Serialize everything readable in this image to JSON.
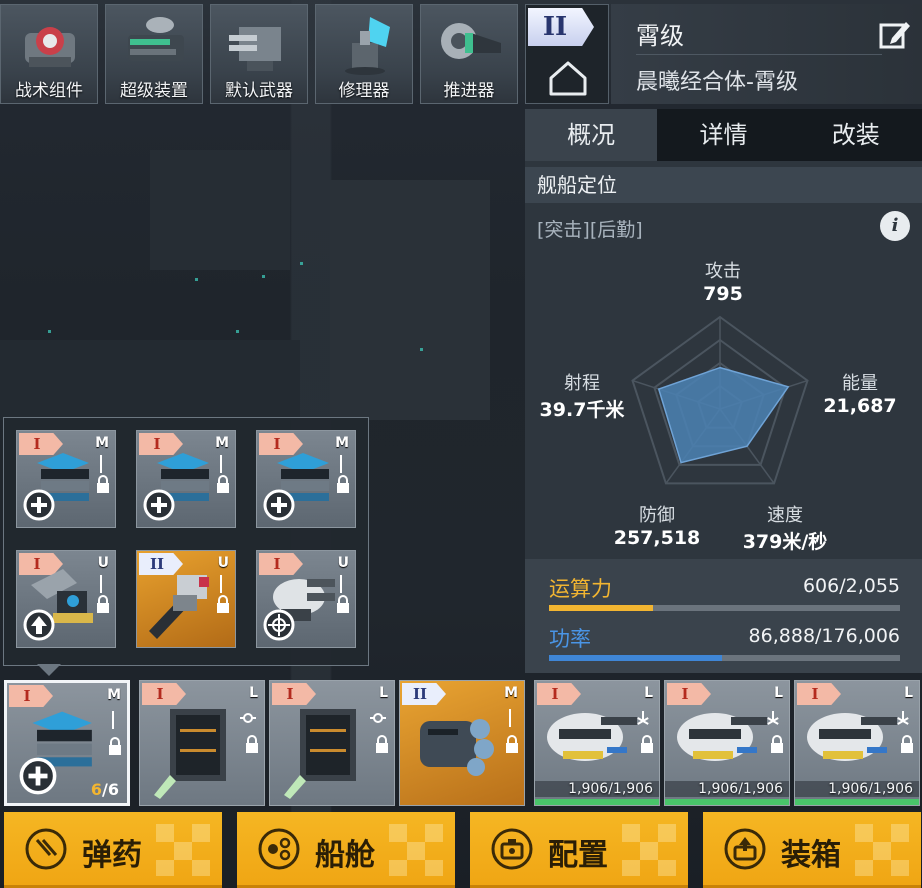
{
  "categories": [
    {
      "label": "战术组件",
      "icon": "tactical-module-icon"
    },
    {
      "label": "超级装置",
      "icon": "super-device-icon"
    },
    {
      "label": "默认武器",
      "icon": "default-weapon-icon"
    },
    {
      "label": "修理器",
      "icon": "repair-device-icon"
    },
    {
      "label": "推进器",
      "icon": "thruster-icon"
    }
  ],
  "ship": {
    "tier": "II",
    "class": "霄级",
    "name": "晨曦经合体-霄级"
  },
  "tabs": [
    "概况",
    "详情",
    "改装"
  ],
  "overview": {
    "section_title": "舰船定位",
    "roles": "[突击][后勤]",
    "info_label": "i",
    "stats": {
      "attack": {
        "name": "攻击",
        "value": "795"
      },
      "energy": {
        "name": "能量",
        "value": "21,687"
      },
      "speed": {
        "name": "速度",
        "value": "379米/秒"
      },
      "defense": {
        "name": "防御",
        "value": "257,518"
      },
      "range": {
        "name": "射程",
        "value": "39.7千米"
      }
    },
    "radar_levels": {
      "attack": 0.45,
      "energy": 0.78,
      "speed": 0.5,
      "defense": 0.72,
      "range": 0.7
    },
    "computing": {
      "label": "运算力",
      "value": "606/2,055",
      "fraction": 0.295,
      "color": "#f2b531"
    },
    "power": {
      "label": "功率",
      "value": "86,888/176,006",
      "fraction": 0.494,
      "color": "#3f86d6"
    }
  },
  "popup_slots": [
    {
      "tier": "I",
      "size": "M",
      "overlay": "plus-icon",
      "art": "module-blue-icon"
    },
    {
      "tier": "I",
      "size": "M",
      "overlay": "plus-icon",
      "art": "module-blue-icon"
    },
    {
      "tier": "I",
      "size": "M",
      "overlay": "plus-icon",
      "art": "module-blue-icon"
    },
    {
      "tier": "I",
      "size": "U",
      "overlay": "up-arrow-icon",
      "art": "turret-icon"
    },
    {
      "tier": "II",
      "size": "U",
      "overlay": "",
      "art": "cannon-icon",
      "gold": true
    },
    {
      "tier": "I",
      "size": "U",
      "overlay": "crosshair-icon",
      "art": "gun-pod-icon"
    }
  ],
  "equipment": [
    {
      "tier": "I",
      "size": "M",
      "art": "module-blue-icon",
      "count_cur": "6",
      "count_tot": "/6",
      "selected": true
    },
    {
      "tier": "I",
      "size": "L",
      "art": "hangar-icon"
    },
    {
      "tier": "I",
      "size": "L",
      "art": "hangar-icon"
    },
    {
      "tier": "II",
      "size": "M",
      "art": "engine-icon",
      "gold": true
    },
    {
      "tier": "I",
      "size": "L",
      "art": "heavy-turret-icon",
      "hp": "1,906/1,906"
    },
    {
      "tier": "I",
      "size": "L",
      "art": "heavy-turret-icon",
      "hp": "1,906/1,906"
    },
    {
      "tier": "I",
      "size": "L",
      "art": "heavy-turret-icon",
      "hp": "1,906/1,906"
    }
  ],
  "actions": [
    {
      "label": "弹药",
      "icon": "ammo-icon"
    },
    {
      "label": "船舱",
      "icon": "cabin-icon"
    },
    {
      "label": "配置",
      "icon": "config-icon"
    },
    {
      "label": "装箱",
      "icon": "crate-icon"
    }
  ]
}
